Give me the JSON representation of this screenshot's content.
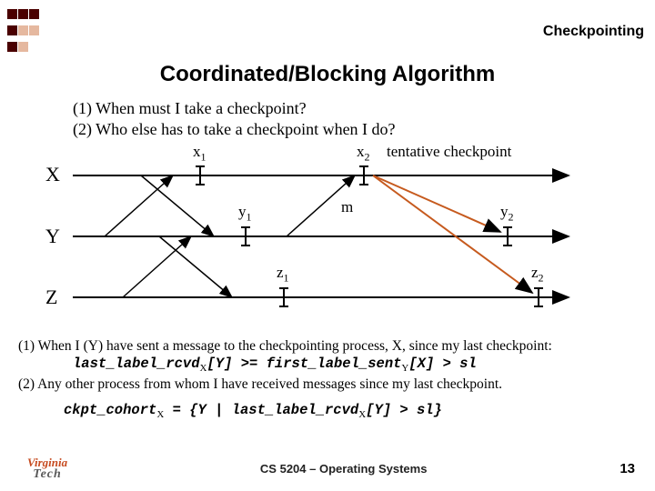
{
  "header": {
    "section_label": "Checkpointing"
  },
  "title": "Coordinated/Blocking Algorithm",
  "questions": {
    "q1": "(1) When must I take a checkpoint?",
    "q2": "(2) Who else has to take a checkpoint when I do?"
  },
  "diagram": {
    "processes": [
      "X",
      "Y",
      "Z"
    ],
    "x1": "x",
    "x1s": "1",
    "x2": "x",
    "x2s": "2",
    "tentative": "tentative checkpoint",
    "y1": "y",
    "y1s": "1",
    "m": "m",
    "y2": "y",
    "y2s": "2",
    "z1": "z",
    "z1s": "1",
    "z2": "z",
    "z2s": "2"
  },
  "explain": {
    "p1": "(1) When I (Y) have sent a message to the checkpointing process, X, since my last checkpoint:",
    "code1a": "last_label_rcvd",
    "code1aX": "X",
    "code1b": "[Y] >= first_label_sent",
    "code1bY": "Y",
    "code1c": "[X] > sl",
    "p2": "(2) Any other process from whom I have received messages since my last checkpoint.",
    "code2a": "ckpt_cohort",
    "code2aX": "X",
    "code2b": " = {Y | last_label_rcvd",
    "code2bX": "X",
    "code2c": "[Y] > sl}"
  },
  "footer": {
    "logo_top": "Virginia",
    "logo_bot": "Tech",
    "course": "CS 5204 – Operating Systems",
    "page": "13"
  }
}
